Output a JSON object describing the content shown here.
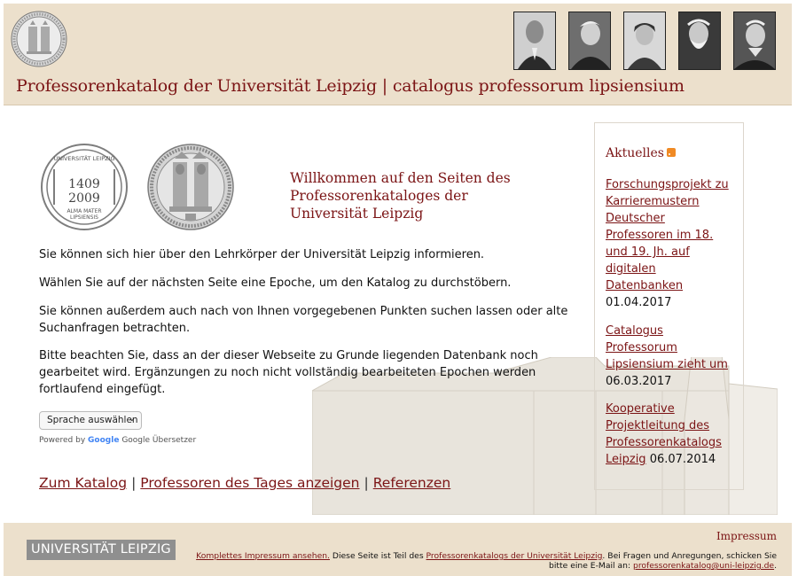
{
  "header": {
    "title": "Professorenkatalog der Universität Leipzig | catalogus professorum lipsiensium",
    "portraits": [
      "portrait-1",
      "portrait-2",
      "portrait-3",
      "portrait-4",
      "portrait-5"
    ]
  },
  "logos": {
    "jubilee": {
      "top": "UNIVERSITÄT LEIPZIG",
      "year_start": "1409",
      "year_end": "2009",
      "bottom_line1": "ALMA MATER",
      "bottom_line2": "LIPSIENSIS"
    }
  },
  "welcome": {
    "line1": "Willkommen auf den Seiten des",
    "line2": "Professorenkataloges der",
    "line3": "Universität Leipzig"
  },
  "paragraphs": {
    "p1": "Sie können sich hier über den Lehrkörper der Universität Leipzig informieren.",
    "p2": "Wählen Sie auf der nächsten Seite eine Epoche, um den Katalog zu durchstöbern.",
    "p3": "Sie können außerdem auch nach von Ihnen vorgegebenen Punkten suchen lassen oder alte Suchanfragen betrachten.",
    "p4": "Bitte beachten Sie, dass an der dieser Webseite zu Grunde liegenden Datenbank noch gearbeitet wird. Ergänzungen zu noch nicht vollständig bearbeiteten Epochen werden fortlaufend eingefügt."
  },
  "translate": {
    "select_label": "Sprache auswählen",
    "powered_prefix": "Powered by",
    "google": "Google",
    "service": "Google Übersetzer"
  },
  "links": {
    "catalog": "Zum Katalog",
    "professors_today": "Professoren des Tages anzeigen",
    "references": "Referenzen",
    "separator": "|"
  },
  "sidebar": {
    "heading": "Aktuelles",
    "news": [
      {
        "title": "Forschungsprojekt zu Karrieremustern Deutscher Professoren im 18. und 19. Jh. auf digitalen Datenbanken",
        "date": "01.04.2017"
      },
      {
        "title": "Catalogus Professorum Lipsiensium zieht um",
        "date": "06.03.2017"
      },
      {
        "title": "Kooperative Projektleitung des Professorenkatalogs Leipzig",
        "date": "06.07.2014"
      }
    ]
  },
  "footer": {
    "logo_text": "UNIVERSITÄT LEIPZIG",
    "impressum_heading": "Impressum",
    "impressum_link": "Komplettes Impressum ansehen.",
    "text_part1": "Diese Seite ist Teil des",
    "catalog_link": "Professorenkatalogs der Universität Leipzig",
    "text_part2": ". Bei Fragen und Anregungen, schicken Sie bitte eine E-Mail an:",
    "email": "professorenkatalog@uni-leipzig.de",
    "text_end": "."
  },
  "colors": {
    "accent": "#7b1415",
    "header_bg": "#ece0cc",
    "footer_bg": "#ece0cc",
    "logo_bg": "#8f8f8f"
  }
}
